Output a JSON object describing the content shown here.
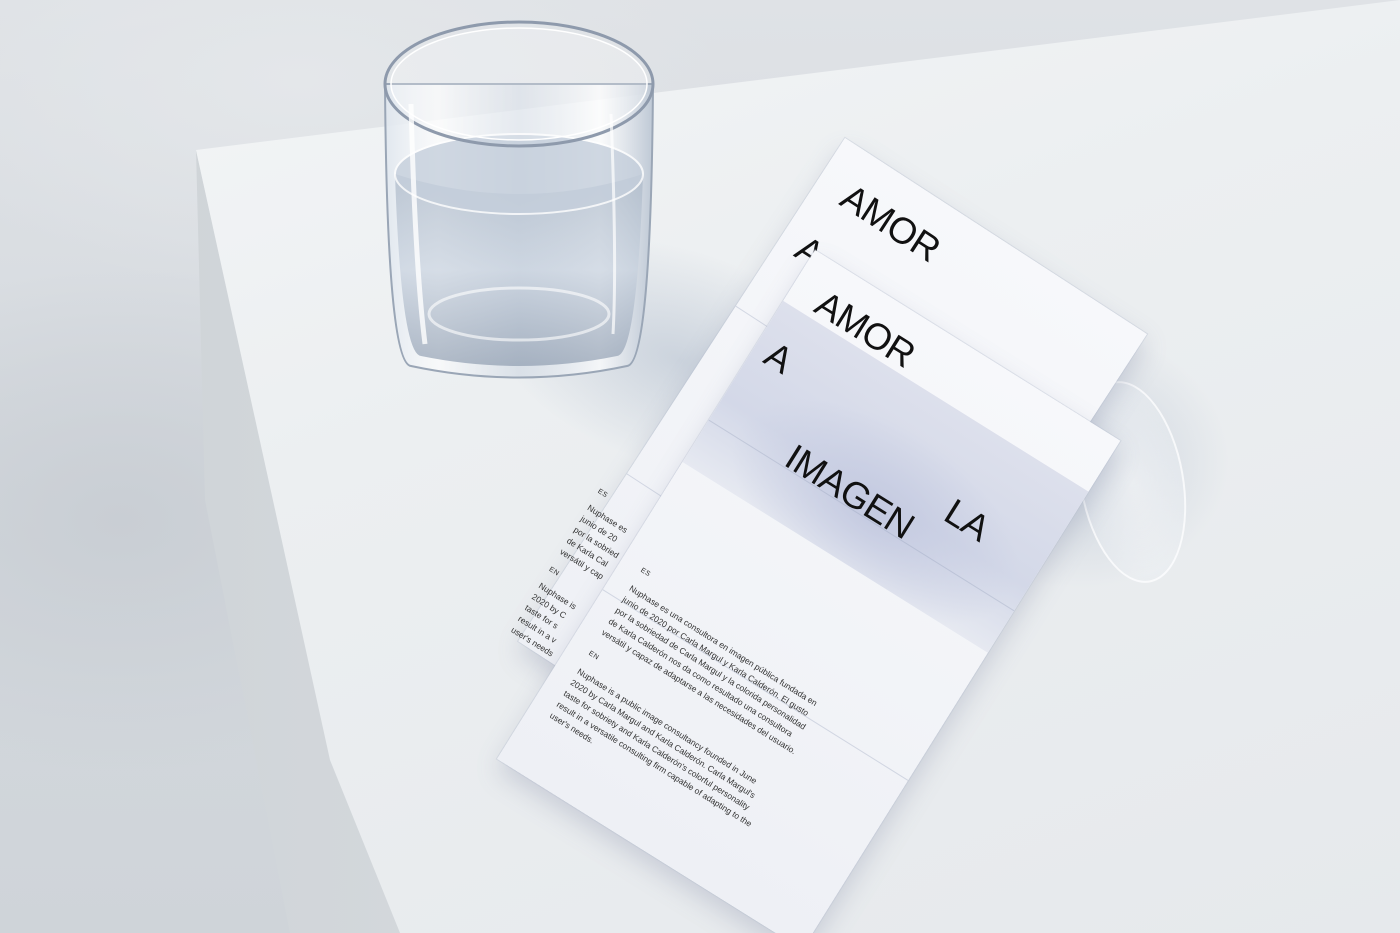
{
  "scene": {
    "description_colors": {
      "table": "#eceff1",
      "background": "#d9dde2",
      "paper": "#f5f6f9",
      "ink": "#111111"
    }
  },
  "back_brochure": {
    "word1": "AMOR",
    "word2": "A",
    "lang_es": "ES",
    "es_lines": [
      "Nuphase es",
      "junio de 20",
      "por la sobried",
      "de Karla Cal",
      "versátil y cap"
    ],
    "lang_en": "EN",
    "en_lines": [
      "Nuphase is",
      "2020 by C",
      "taste for s",
      "result in a v",
      "user's needs"
    ]
  },
  "front_brochure": {
    "word1": "AMOR",
    "word2": "A",
    "word3": "LA",
    "word4": "IMAGEN",
    "lang_es": "ES",
    "es_lines": [
      "Nuphase es una consultora en imagen pública fundada en",
      "junio de 2020 por Carla Margul y Karla Calderón. El gusto",
      "por la sobriedad de Carla Margul y la colorida personalidad",
      "de Karla Calderón nos da como resultado una consultora",
      "versátil y capaz de adaptarse a las necesidades del usuario."
    ],
    "lang_en": "EN",
    "en_lines": [
      "Nuphase is a public image consultancy founded in June",
      "2020 by Carla Margul and Karla Calderón. Carla Margul's",
      "taste for sobriety and Karla Calderón's colorful personality",
      "result in a versatile consulting firm capable of adapting to the",
      "user's needs."
    ]
  }
}
